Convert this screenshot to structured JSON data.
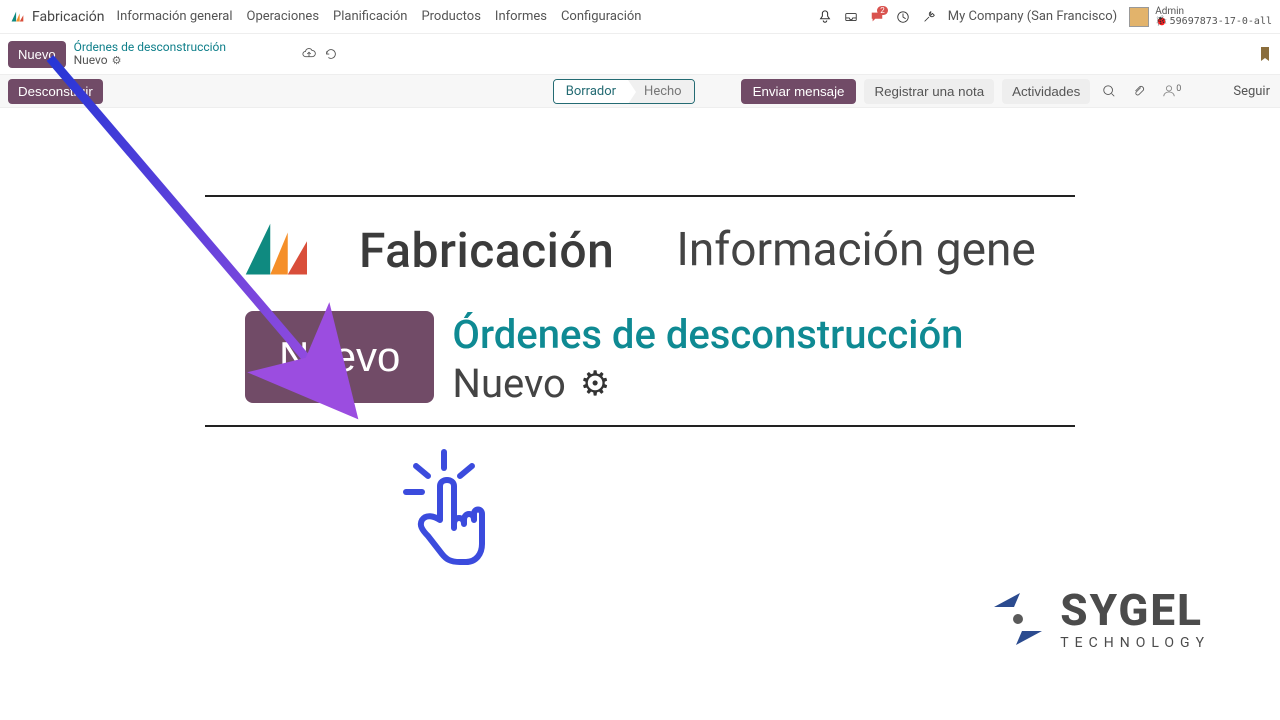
{
  "topnav": {
    "app_name": "Fabricación",
    "menu": [
      "Información general",
      "Operaciones",
      "Planificación",
      "Productos",
      "Informes",
      "Configuración"
    ],
    "company": "My Company (San Francisco)",
    "admin_label": "Admin",
    "db_name": "59697873-17-0-all",
    "msg_badge": "2"
  },
  "breadcrumb": {
    "new_button": "Nuevo",
    "line1": "Órdenes de desconstrucción",
    "line2": "Nuevo"
  },
  "toolbar": {
    "deconstruct": "Desconstruir",
    "status_active": "Borrador",
    "status_next": "Hecho",
    "send_msg": "Enviar mensaje",
    "log_note": "Registrar una nota",
    "activities": "Actividades",
    "follow_count": "0",
    "follow_label": "Seguir"
  },
  "zoom": {
    "app_name": "Fabricación",
    "info": "Información gene",
    "new_button": "Nuevo",
    "bc_top": "Órdenes de desconstrucción",
    "bc_bot": "Nuevo"
  },
  "sygel": {
    "name": "SYGEL",
    "sub": "TECHNOLOGY"
  }
}
